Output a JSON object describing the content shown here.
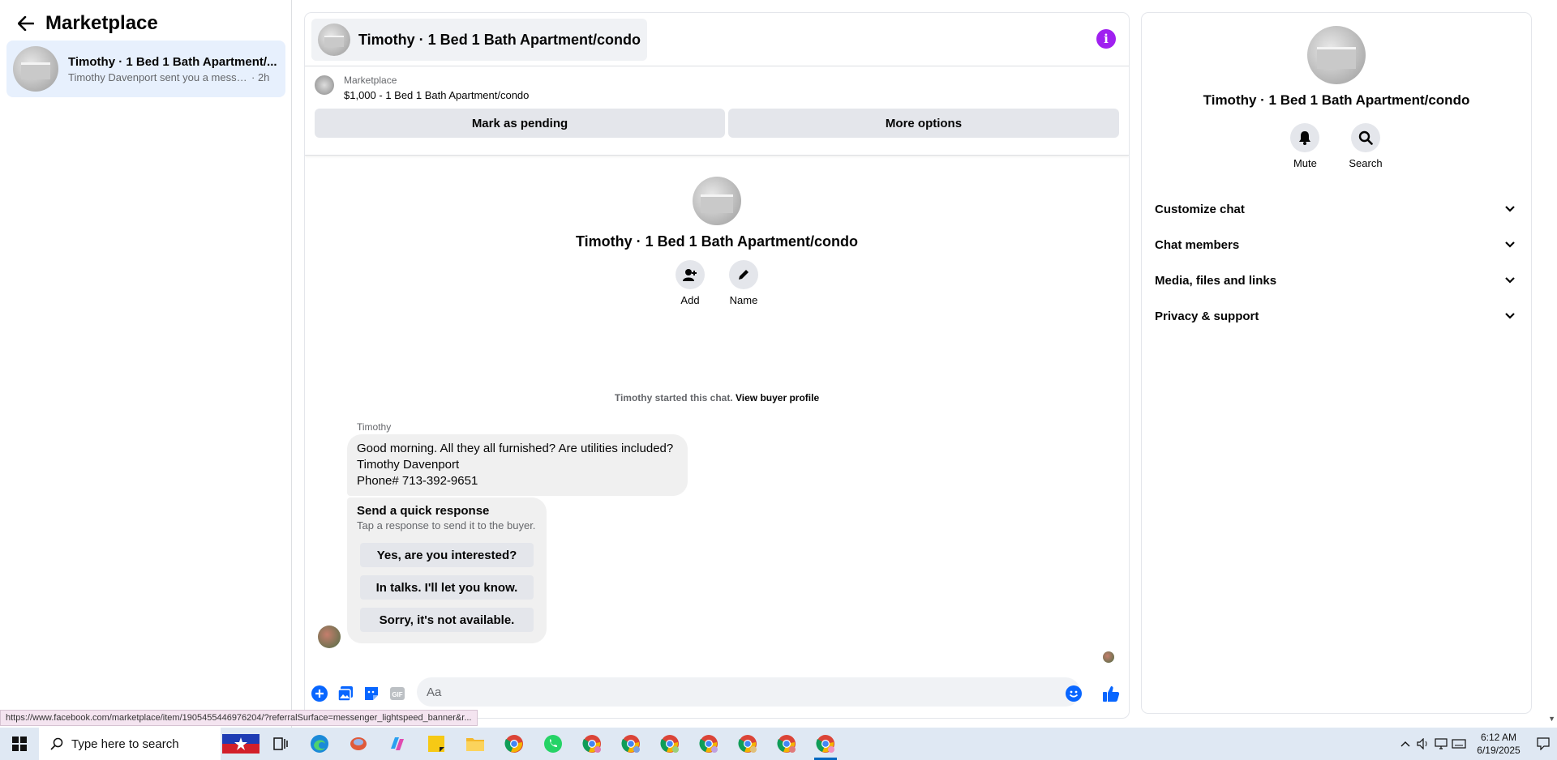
{
  "left": {
    "title": "Marketplace",
    "conversation": {
      "title": "Timothy · 1 Bed 1 Bath Apartment/...",
      "snippet": "Timothy Davenport sent you a messa...",
      "time": "· 2h"
    }
  },
  "header": {
    "title": "Timothy · 1 Bed 1 Bath Apartment/condo"
  },
  "listing": {
    "label": "Marketplace",
    "price_title": "$1,000 - 1 Bed 1 Bath Apartment/condo",
    "mark_pending": "Mark as pending",
    "more_options": "More options"
  },
  "profile": {
    "name": "Timothy · 1 Bed 1 Bath Apartment/condo",
    "add_label": "Add",
    "name_label": "Name"
  },
  "chat": {
    "started_text": "Timothy started this chat.",
    "view_profile": "View buyer profile",
    "sender": "Timothy",
    "message_lines": [
      "Good morning. All they all furnished? Are utilities included?",
      "Timothy Davenport",
      "Phone# 713-392-9651"
    ],
    "quick_response": {
      "title": "Send a quick response",
      "subtitle": "Tap a response to send it to the buyer.",
      "options": [
        "Yes, are you interested?",
        "In talks. I'll let you know.",
        "Sorry, it's not available."
      ]
    }
  },
  "composer": {
    "placeholder": "Aa"
  },
  "right_panel": {
    "name": "Timothy · 1 Bed 1 Bath Apartment/condo",
    "mute_label": "Mute",
    "search_label": "Search",
    "sections": [
      "Customize chat",
      "Chat members",
      "Media, files and links",
      "Privacy & support"
    ]
  },
  "status_url": "https://www.facebook.com/marketplace/item/1905455446976204/?referralSurface=messenger_lightspeed_banner&r...",
  "taskbar": {
    "search_placeholder": "Type here to search",
    "time": "6:12 AM",
    "date": "6/19/2025"
  },
  "colors": {
    "accent": "#0866ff",
    "info": "#a020f0",
    "selected_bg": "#e7f0fd"
  }
}
